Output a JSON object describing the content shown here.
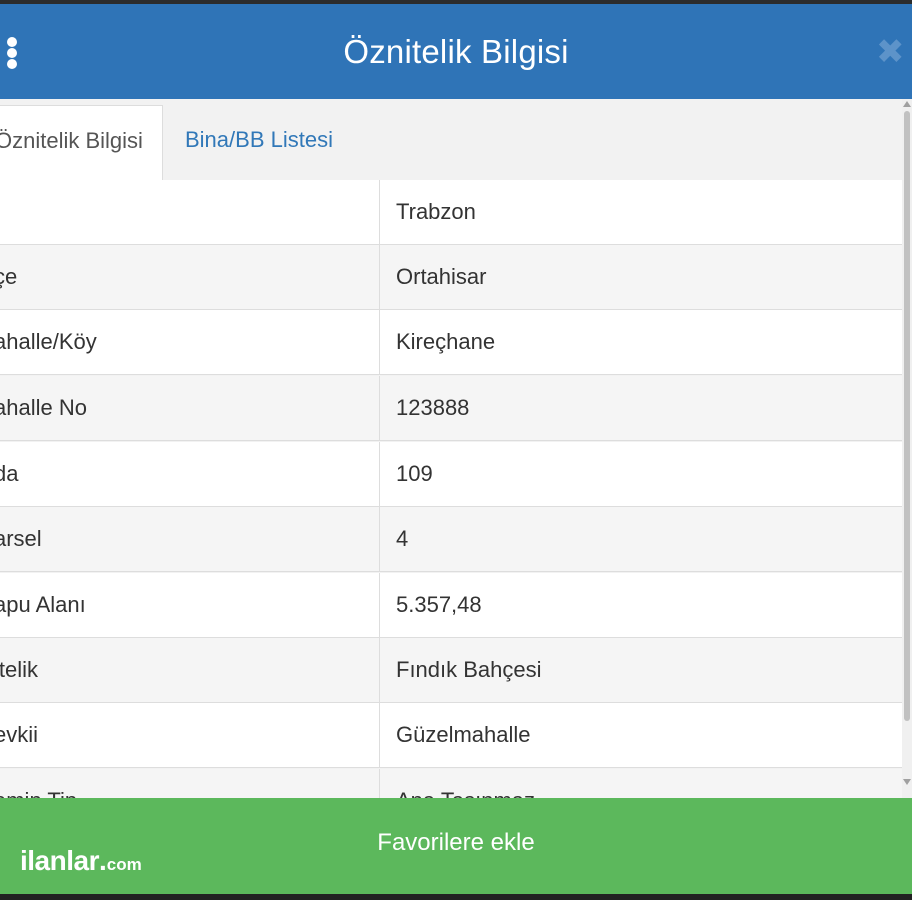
{
  "header": {
    "title": "Öznitelik Bilgisi",
    "close_symbol": "✖",
    "menu_icon": "vertical-dots-icon",
    "background_color": "#2f74b7"
  },
  "tabs": [
    {
      "label": "Öznitelik Bilgisi",
      "active": true
    },
    {
      "label": "Bina/BB Listesi",
      "active": false
    }
  ],
  "table": {
    "rows": [
      {
        "label": "",
        "value": "Trabzon"
      },
      {
        "label": "çe",
        "value": "Ortahisar"
      },
      {
        "label": "ahalle/Köy",
        "value": "Kireçhane"
      },
      {
        "label": "ahalle No",
        "value": "123888"
      },
      {
        "label": "da",
        "value": "109"
      },
      {
        "label": "arsel",
        "value": "4"
      },
      {
        "label": "apu Alanı",
        "value": "5.357,48"
      },
      {
        "label": "itelik",
        "value": "Fındık Bahçesi"
      },
      {
        "label": "evkii",
        "value": "Güzelmahalle"
      },
      {
        "label": "amin Tip",
        "value": "Ana Taşınmaz"
      }
    ]
  },
  "footer": {
    "button_label": "Favorilere ekle",
    "background_color": "#5cb85c",
    "watermark": {
      "main": "ilanlar",
      "dot": ".",
      "tld": "com"
    }
  }
}
